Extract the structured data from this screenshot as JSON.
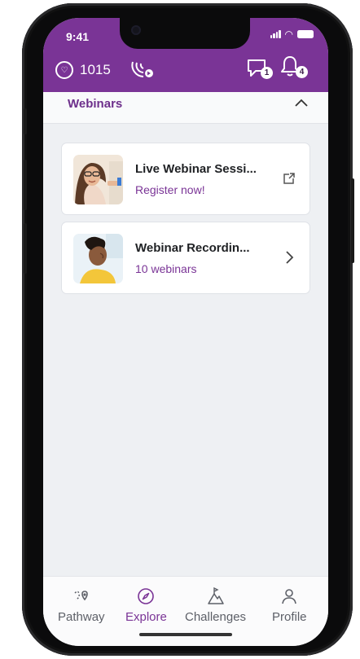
{
  "status_bar": {
    "time": "9:41"
  },
  "header": {
    "points_value": "1015",
    "messages_count": "1",
    "notifications_count": "4"
  },
  "section": {
    "title": "Webinars"
  },
  "cards": [
    {
      "title": "Live Webinar Sessi...",
      "subtitle": "Register now!",
      "action_icon": "external-link-icon"
    },
    {
      "title": "Webinar Recordin...",
      "subtitle": "10 webinars",
      "action_icon": "chevron-right-icon"
    }
  ],
  "bottom_nav": [
    {
      "label": "Pathway",
      "icon": "pathway-icon"
    },
    {
      "label": "Explore",
      "icon": "compass-icon",
      "active": true
    },
    {
      "label": "Challenges",
      "icon": "mountain-icon"
    },
    {
      "label": "Profile",
      "icon": "person-icon"
    }
  ],
  "colors": {
    "brand": "#7a3496",
    "background": "#eef0f3"
  }
}
